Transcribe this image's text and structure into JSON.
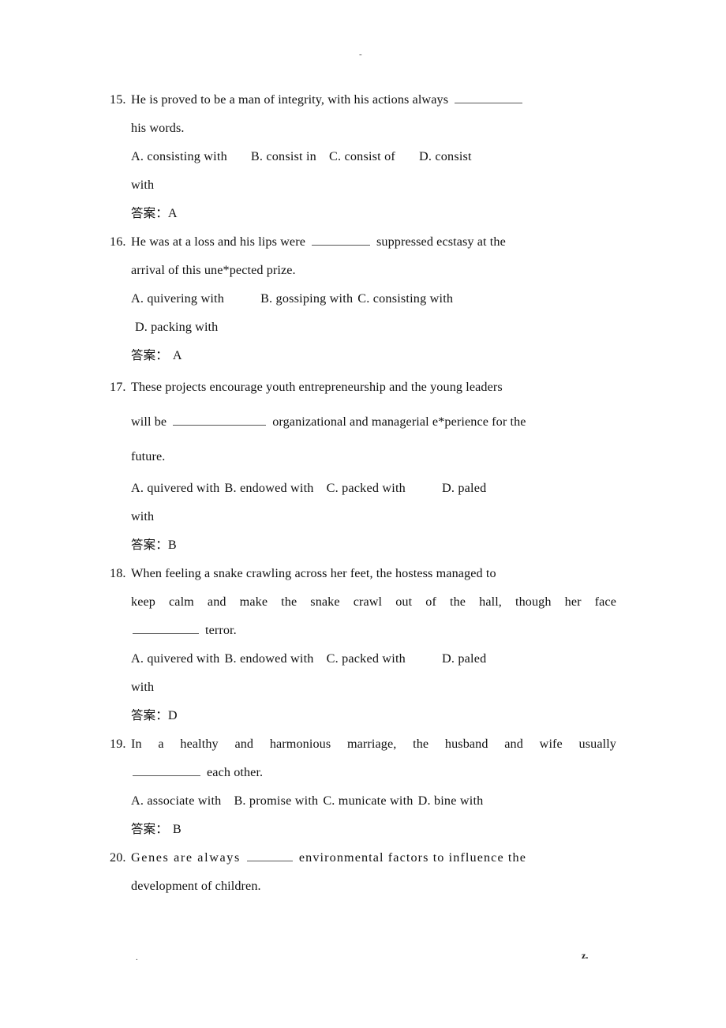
{
  "page": {
    "header_mark": "-",
    "footer_left_mark": ".",
    "footer_right_mark": "z.",
    "answer_label": "答案："
  },
  "questions": [
    {
      "number": "15.",
      "stem_line1_a": "He is proved to be a man of integrity, with his actions always",
      "stem_line2": "his words.",
      "options_line1_a": "A. consisting with",
      "options_line1_b": "B. consist in",
      "options_line1_c": "C. consist of",
      "options_line1_d": "D. consist",
      "options_line2": "with",
      "answer": "A"
    },
    {
      "number": "16.",
      "stem_line1_a": "He was at a loss and his lips were",
      "stem_line1_b": "suppressed ecstasy at the",
      "stem_line2": "arrival of this une*pected prize.",
      "options_line1_a": "A. quivering with",
      "options_line1_b": "B. gossiping with",
      "options_line1_c": "C. consisting with",
      "options_line2": "D. packing with",
      "answer": "A"
    },
    {
      "number": "17.",
      "stem_line1": "These projects encourage youth entrepreneurship and the young leaders",
      "stem_line2_a": "will be",
      "stem_line2_b": "organizational and managerial e*perience for the",
      "stem_line3": "future.",
      "options_line1_a": "A. quivered with",
      "options_line1_b": "B. endowed with",
      "options_line1_c": "C. packed with",
      "options_line1_d": "D.    paled",
      "options_line2": "with",
      "answer": "B"
    },
    {
      "number": "18.",
      "stem_line1": "When feeling a snake crawling across her feet, the hostess managed to",
      "stem_line2": "keep calm and make the snake crawl out of the hall, though her face",
      "stem_line3_b": "terror.",
      "options_line1_a": "A. quivered with",
      "options_line1_b": "B. endowed with",
      "options_line1_c": "C. packed with",
      "options_line1_d": "D.    paled",
      "options_line2": "with",
      "answer": "D"
    },
    {
      "number": "19.",
      "stem_line1": "In a healthy and harmonious marriage, the husband and wife usually",
      "stem_line2_b": "each other.",
      "options_line1_a": "A. associate with",
      "options_line1_b": "B. promise with",
      "options_line1_c": "C. municate with",
      "options_line1_d": "D. bine with",
      "answer": "B"
    },
    {
      "number": "20.",
      "stem_line1_a": "Genes are always",
      "stem_line1_b": "environmental factors to influence the",
      "stem_line2": "development of children."
    }
  ]
}
